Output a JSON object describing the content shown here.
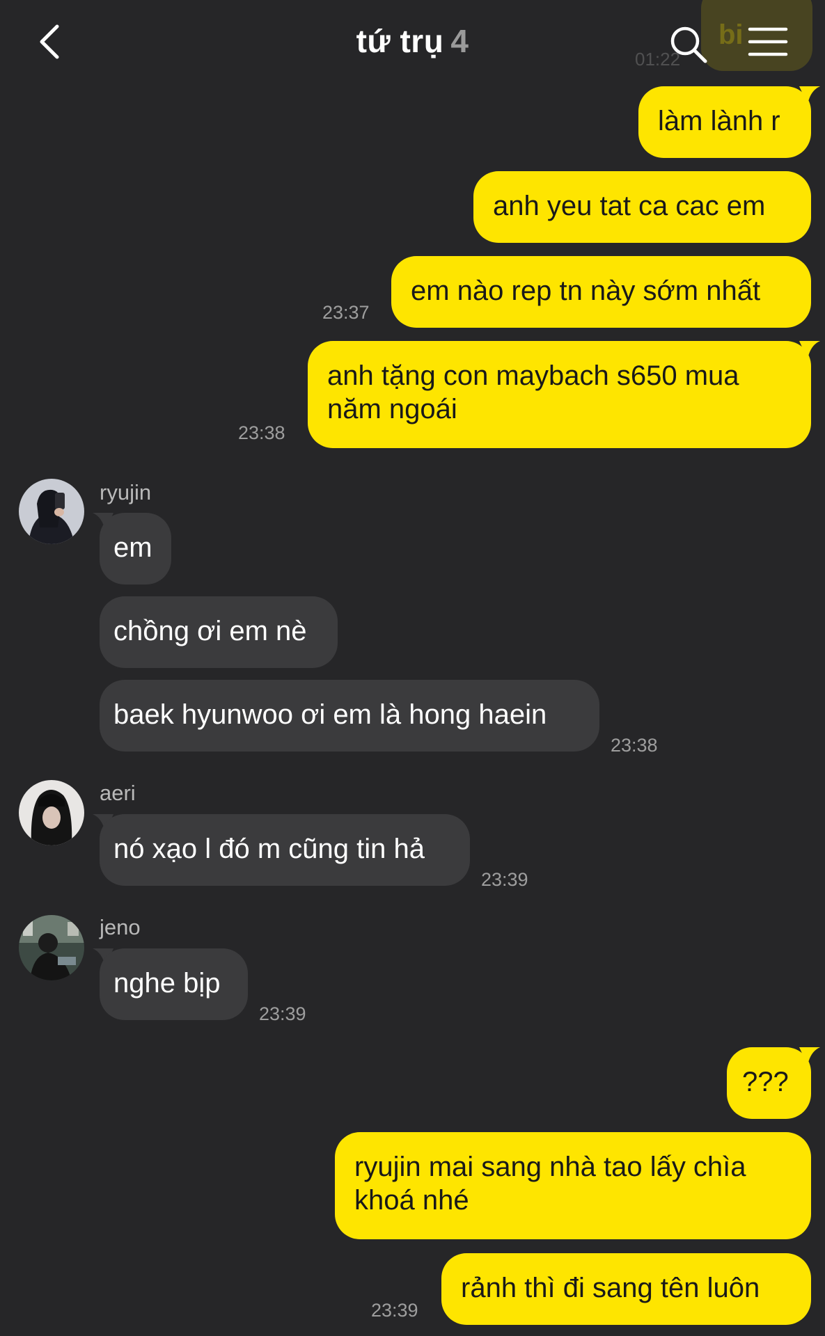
{
  "header": {
    "title": "tứ trụ",
    "member_count": "4",
    "peek_text": "bi",
    "peek_time": "01:22"
  },
  "colors": {
    "background": "#262628",
    "my_bubble": "#FEE500",
    "their_bubble": "#3b3b3d"
  },
  "messages": {
    "m1": "làm lành r",
    "m2": "anh yeu tat ca cac em",
    "m3": "em nào rep tn này sớm nhất",
    "m3_time": "23:37",
    "m4_line1": "anh tặng con maybach s650 mua",
    "m4_line2": "năm ngoái",
    "m4_time": "23:38",
    "ryujin_name": "ryujin",
    "r1": "em",
    "r2": "chồng ơi em nè",
    "r3": "baek hyunwoo ơi em là hong haein",
    "r3_time": "23:38",
    "aeri_name": "aeri",
    "a1": "nó xạo l đó m cũng tin hả",
    "a1_time": "23:39",
    "jeno_name": "jeno",
    "j1": "nghe bịp",
    "j1_time": "23:39",
    "m5": "???",
    "m6_line1": "ryujin mai sang nhà tao lấy chìa",
    "m6_line2": "khoá nhé",
    "m7": "rảnh thì đi sang tên luôn",
    "m7_time": "23:39"
  }
}
